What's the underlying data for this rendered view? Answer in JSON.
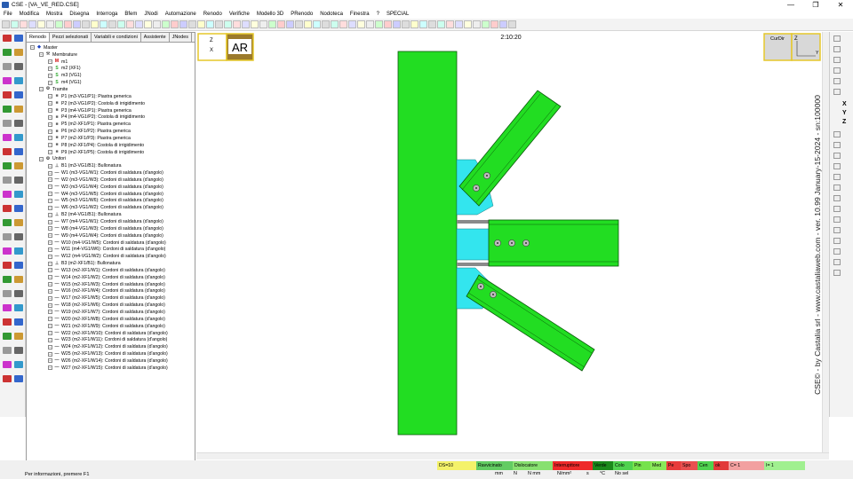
{
  "window": {
    "title": "CSE - [VA_VE_RED.CSE]",
    "minimize": "—",
    "maximize": "❐",
    "close": "✕"
  },
  "menu": [
    "File",
    "Modifica",
    "Mostra",
    "Disegna",
    "Interroga",
    "Bfem",
    "JNodi",
    "Automazione",
    "Renodo",
    "Verifiche",
    "Modello 3D",
    "PRenodo",
    "Nodoteca",
    "Finestra",
    "?",
    "SPECIAL"
  ],
  "panel": {
    "tabs": [
      "Renodo",
      "Pezzi selezionati",
      "Variabili e condizioni",
      "Assistente",
      "JNodes"
    ],
    "tree": [
      {
        "level": 0,
        "label": "Master",
        "icon": "◆",
        "color": "#1a3fbf"
      },
      {
        "level": 1,
        "label": "Membrature",
        "icon": "⚒",
        "color": "#555"
      },
      {
        "level": 2,
        "label": "m1",
        "icon": "M",
        "color": "#cc0000"
      },
      {
        "level": 2,
        "label": "m2 (XF1)",
        "icon": "S",
        "color": "#2fa82f"
      },
      {
        "level": 2,
        "label": "m3 (VG1)",
        "icon": "S",
        "color": "#2fa82f"
      },
      {
        "level": 2,
        "label": "m4 (VG1)",
        "icon": "S",
        "color": "#2fa82f"
      },
      {
        "level": 1,
        "label": "Tramite",
        "icon": "⚙",
        "color": "#444"
      },
      {
        "level": 2,
        "label": "P1 (m3-VG1/P1): Piastra generica",
        "icon": "■",
        "color": "#666"
      },
      {
        "level": 2,
        "label": "P2 (m3-VG1/P2): Costola di irrigidimento",
        "icon": "■",
        "color": "#666"
      },
      {
        "level": 2,
        "label": "P3 (m4-VG1/P1): Piastra generica",
        "icon": "■",
        "color": "#666"
      },
      {
        "level": 2,
        "label": "P4 (m4-VG1/P2): Costola di irrigidimento",
        "icon": "■",
        "color": "#666"
      },
      {
        "level": 2,
        "label": "P5 (m2-XF1/P1): Piastra generica",
        "icon": "■",
        "color": "#666"
      },
      {
        "level": 2,
        "label": "P6 (m2-XF1/P2): Piastra generica",
        "icon": "■",
        "color": "#666"
      },
      {
        "level": 2,
        "label": "P7 (m2-XF1/P3): Piastra generica",
        "icon": "■",
        "color": "#666"
      },
      {
        "level": 2,
        "label": "P8 (m2-XF1/P4): Costola di irrigidimento",
        "icon": "■",
        "color": "#666"
      },
      {
        "level": 2,
        "label": "P9 (m2-XF1/P5): Costola di irrigidimento",
        "icon": "■",
        "color": "#666"
      },
      {
        "level": 1,
        "label": "Unitori",
        "icon": "⚙",
        "color": "#444"
      },
      {
        "level": 2,
        "label": "B1 (m3-VG1/B1): Bullonatura",
        "icon": "⊥",
        "color": "#444"
      },
      {
        "level": 2,
        "label": "W1 (m3-VG1/W1): Cordoni di saldatura (d'angolo)",
        "icon": "—",
        "color": "#444"
      },
      {
        "level": 2,
        "label": "W2 (m3-VG1/W3): Cordoni di saldatura (d'angolo)",
        "icon": "—",
        "color": "#444"
      },
      {
        "level": 2,
        "label": "W3 (m3-VG1/W4): Cordoni di saldatura (d'angolo)",
        "icon": "—",
        "color": "#444"
      },
      {
        "level": 2,
        "label": "W4 (m3-VG1/W5): Cordoni di saldatura (d'angolo)",
        "icon": "—",
        "color": "#444"
      },
      {
        "level": 2,
        "label": "W5 (m3-VG1/W6): Cordoni di saldatura (d'angolo)",
        "icon": "—",
        "color": "#444"
      },
      {
        "level": 2,
        "label": "W6 (m3-VG1/W2): Cordoni di saldatura (d'angolo)",
        "icon": "—",
        "color": "#444"
      },
      {
        "level": 2,
        "label": "B2 (m4-VG1/B1): Bullonatura",
        "icon": "⊥",
        "color": "#444"
      },
      {
        "level": 2,
        "label": "W7 (m4-VG1/W1): Cordoni di saldatura (d'angolo)",
        "icon": "—",
        "color": "#444"
      },
      {
        "level": 2,
        "label": "W8 (m4-VG1/W3): Cordoni di saldatura (d'angolo)",
        "icon": "—",
        "color": "#444"
      },
      {
        "level": 2,
        "label": "W9 (m4-VG1/W4): Cordoni di saldatura (d'angolo)",
        "icon": "—",
        "color": "#444"
      },
      {
        "level": 2,
        "label": "W10 (m4-VG1/W5): Cordoni di saldatura (d'angolo)",
        "icon": "—",
        "color": "#444"
      },
      {
        "level": 2,
        "label": "W11 (m4-VG1/W6): Cordoni di saldatura (d'angolo)",
        "icon": "—",
        "color": "#444"
      },
      {
        "level": 2,
        "label": "W12 (m4-VG1/W2): Cordoni di saldatura (d'angolo)",
        "icon": "—",
        "color": "#444"
      },
      {
        "level": 2,
        "label": "B3 (m2-XF1/B1): Bullonatura",
        "icon": "⊥",
        "color": "#444"
      },
      {
        "level": 2,
        "label": "W13 (m2-XF1/W1): Cordoni di saldatura (d'angolo)",
        "icon": "—",
        "color": "#444"
      },
      {
        "level": 2,
        "label": "W14 (m2-XF1/W2): Cordoni di saldatura (d'angolo)",
        "icon": "—",
        "color": "#444"
      },
      {
        "level": 2,
        "label": "W15 (m2-XF1/W3): Cordoni di saldatura (d'angolo)",
        "icon": "—",
        "color": "#444"
      },
      {
        "level": 2,
        "label": "W16 (m2-XF1/W4): Cordoni di saldatura (d'angolo)",
        "icon": "—",
        "color": "#444"
      },
      {
        "level": 2,
        "label": "W17 (m2-XF1/W5): Cordoni di saldatura (d'angolo)",
        "icon": "—",
        "color": "#444"
      },
      {
        "level": 2,
        "label": "W18 (m2-XF1/W6): Cordoni di saldatura (d'angolo)",
        "icon": "—",
        "color": "#444"
      },
      {
        "level": 2,
        "label": "W19 (m2-XF1/W7): Cordoni di saldatura (d'angolo)",
        "icon": "—",
        "color": "#444"
      },
      {
        "level": 2,
        "label": "W20 (m2-XF1/W8): Cordoni di saldatura (d'angolo)",
        "icon": "—",
        "color": "#444"
      },
      {
        "level": 2,
        "label": "W21 (m2-XF1/W9): Cordoni di saldatura (d'angolo)",
        "icon": "—",
        "color": "#444"
      },
      {
        "level": 2,
        "label": "W22 (m2-XF1/W10): Cordoni di saldatura (d'angolo)",
        "icon": "—",
        "color": "#444"
      },
      {
        "level": 2,
        "label": "W23 (m2-XF1/W11): Cordoni di saldatura (d'angolo)",
        "icon": "—",
        "color": "#444"
      },
      {
        "level": 2,
        "label": "W24 (m2-XF1/W12): Cordoni di saldatura (d'angolo)",
        "icon": "—",
        "color": "#444"
      },
      {
        "level": 2,
        "label": "W25 (m2-XF1/W13): Cordoni di saldatura (d'angolo)",
        "icon": "—",
        "color": "#444"
      },
      {
        "level": 2,
        "label": "W26 (m2-XF1/W14): Cordoni di saldatura (d'angolo)",
        "icon": "—",
        "color": "#444"
      },
      {
        "level": 2,
        "label": "W27 (m2-XF1/W15): Cordoni di saldatura (d'angolo)",
        "icon": "—",
        "color": "#444"
      }
    ]
  },
  "canvas": {
    "view_label": "AR",
    "time": "2:10:20",
    "cur_dir": "CurDir",
    "axis_z": "Z",
    "axis_x": "X",
    "axis_y": "Y",
    "stamp": "CSE© - by Castalia srl - www.castaliaweb.com - ver. 10.99 January-15-2024 - sn:100000",
    "colors": {
      "member": "#22dd22",
      "plate": "#33e5ee",
      "bolt": "#bbbbbb",
      "member_edge": "#0a5a0a"
    }
  },
  "right_axes": [
    "X",
    "Y",
    "Z"
  ],
  "status": {
    "message": "Per informazioni, premere F1",
    "legend": [
      {
        "label": "DS=10",
        "bg": "#f4f26a"
      },
      {
        "label": "Ravvicinato",
        "bg": "#63cc63"
      },
      {
        "label": "Dislocatore",
        "bg": "#88e070"
      },
      {
        "label": "Interrupttore",
        "bg": "#ee2a2a"
      },
      {
        "label": "Verde",
        "bg": "#1c8a1c"
      },
      {
        "label": "Colo",
        "bg": "#4fd24f"
      },
      {
        "label": "Pin",
        "bg": "#76e24c"
      },
      {
        "label": "Med",
        "bg": "#8ae85a"
      },
      {
        "label": "Pe",
        "bg": "#e83a3a"
      },
      {
        "label": "Spo",
        "bg": "#e85050"
      },
      {
        "label": "Cen",
        "bg": "#4fd24f"
      },
      {
        "label": "ok",
        "bg": "#e23a3a"
      },
      {
        "label": "C= 1",
        "bg": "#f2a0a0"
      },
      {
        "label": "I= 1",
        "bg": "#a0f090"
      }
    ],
    "units": [
      "mm",
      "N",
      "N mm",
      "N/mm²",
      "s",
      "°C",
      "No sel"
    ]
  }
}
